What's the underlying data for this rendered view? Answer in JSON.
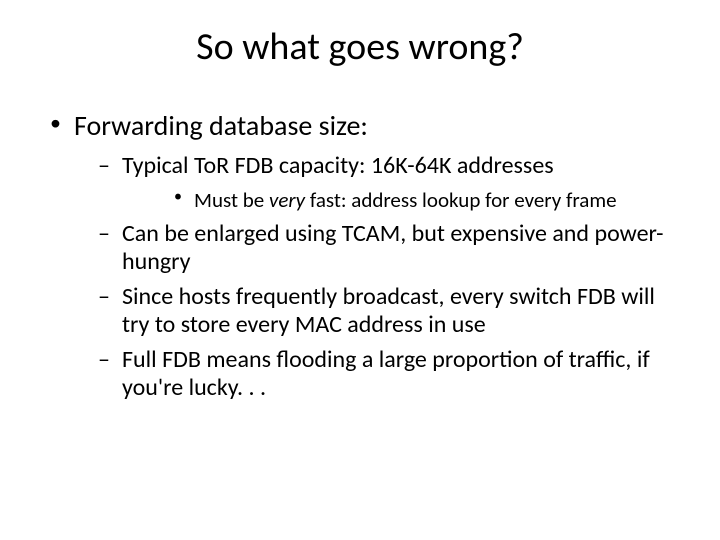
{
  "title": "So what goes wrong?",
  "bullets": {
    "l1": "Forwarding database size:",
    "l2a": "Typical ToR FDB capacity: 16K-64K addresses",
    "l3a_pre": "Must be ",
    "l3a_em": "very",
    "l3a_post": " fast: address lookup for every frame",
    "l2b": "Can be enlarged using TCAM, but expensive and power-hungry",
    "l2c": "Since hosts frequently broadcast, every switch FDB will try to store every MAC address in use",
    "l2d": "Full FDB means flooding a large proportion of traffic, if you're lucky. . ."
  }
}
